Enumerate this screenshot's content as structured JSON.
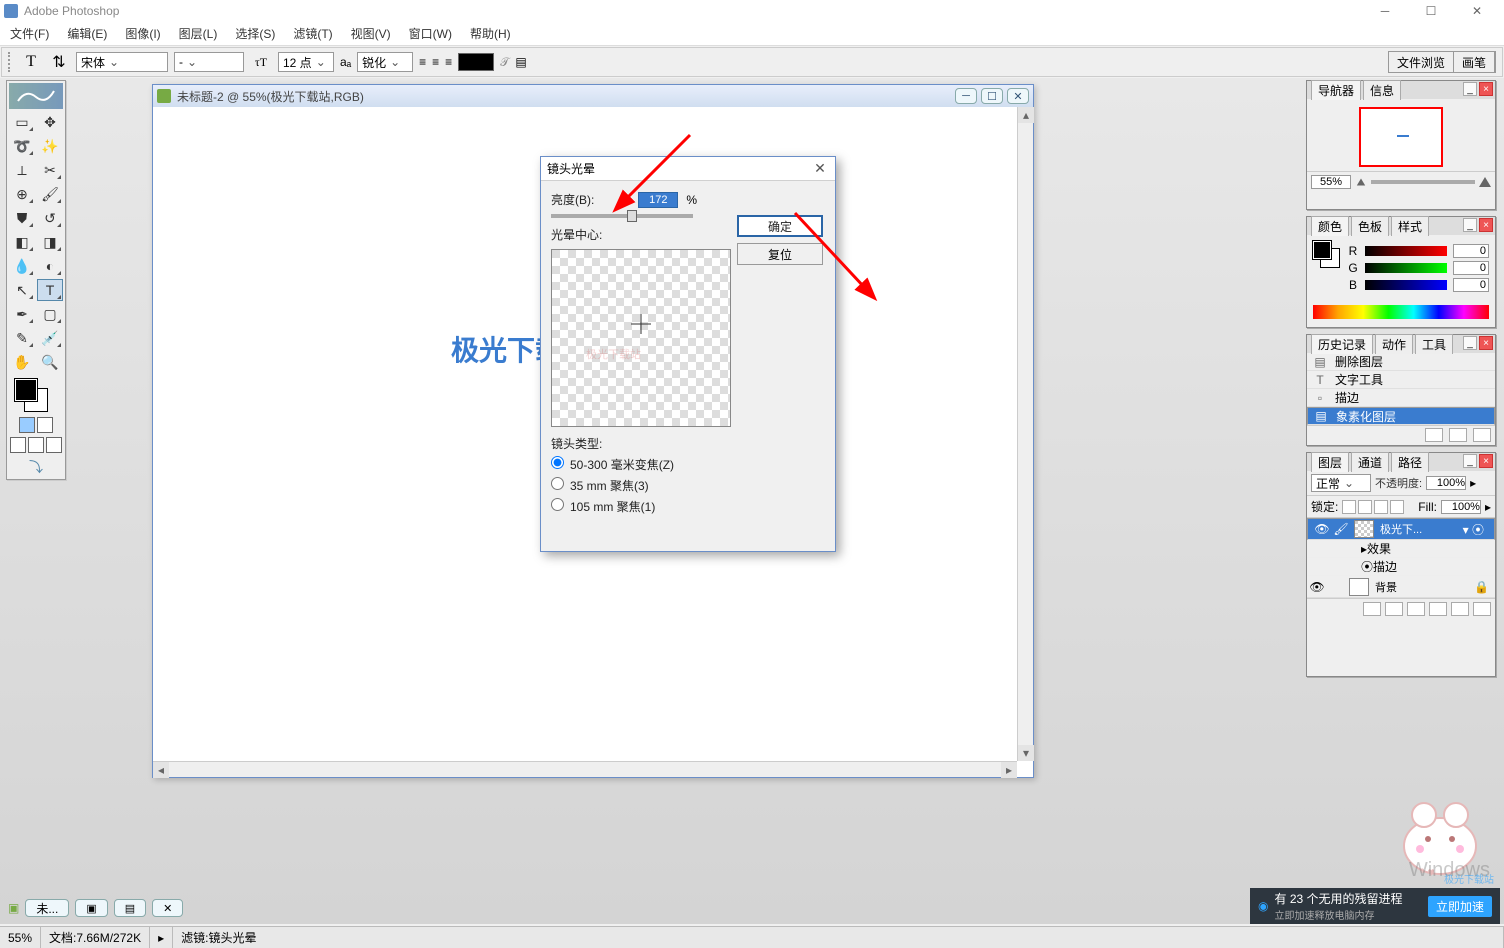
{
  "app": {
    "title": "Adobe Photoshop"
  },
  "menu": {
    "file": "文件(F)",
    "edit": "编辑(E)",
    "image": "图像(I)",
    "layer": "图层(L)",
    "select": "选择(S)",
    "filter": "滤镜(T)",
    "view": "视图(V)",
    "window": "窗口(W)",
    "help": "帮助(H)"
  },
  "options": {
    "font_family": "宋体",
    "font_style": "-",
    "font_size": "12 点",
    "aa_label": "aₐ",
    "aa_mode": "锐化",
    "tabs": {
      "a": "文件浏览",
      "b": "画笔"
    }
  },
  "document": {
    "title": "未标题-2 @ 55%(极光下载站,RGB)",
    "canvas_text": "极光下载"
  },
  "dialog": {
    "title": "镜头光晕",
    "brightness_label": "亮度(B):",
    "brightness_value": "172",
    "percent": "%",
    "center_label": "光晕中心:",
    "lens_type_label": "镜头类型:",
    "lens_options": {
      "opt1": "50-300 毫米变焦(Z)",
      "opt2": "35 mm 聚焦(3)",
      "opt3": "105 mm 聚焦(1)"
    },
    "btn_ok": "确定",
    "btn_reset": "复位",
    "ghost_text": "极光下载站"
  },
  "navigator": {
    "tabs": {
      "nav": "导航器",
      "info": "信息"
    },
    "zoom": "55%"
  },
  "color": {
    "tabs": {
      "color": "颜色",
      "swatch": "色板",
      "style": "样式"
    },
    "r_label": "R",
    "g_label": "G",
    "b_label": "B",
    "r": "0",
    "g": "0",
    "b": "0"
  },
  "history": {
    "tabs": {
      "hist": "历史记录",
      "act": "动作",
      "tool": "工具"
    },
    "items": {
      "i1": "删除图层",
      "i2": "文字工具",
      "i3": "描边",
      "i4": "象素化图层"
    }
  },
  "layers": {
    "tabs": {
      "lay": "图层",
      "chan": "通道",
      "path": "路径"
    },
    "blend": "正常",
    "opacity_label": "不透明度:",
    "opacity_val": "100%",
    "lock_label": "锁定:",
    "fill_label": "Fill:",
    "fill_val": "100%",
    "layer1": "极光下...",
    "fx_label": "效果",
    "stroke_label": "描边",
    "bg_label": "背景"
  },
  "docbar": {
    "item": "未..."
  },
  "status": {
    "zoom": "55%",
    "docinfo": "文档:7.66M/272K",
    "filter": "滤镜:镜头光晕"
  },
  "overlay": {
    "windows_ghost": "Windows",
    "noti_text": "有 23 个无用的残留进程",
    "noti_sub": "立即加速释放电脑内存",
    "accel": "立即加速",
    "watermark": "极光下载站"
  }
}
